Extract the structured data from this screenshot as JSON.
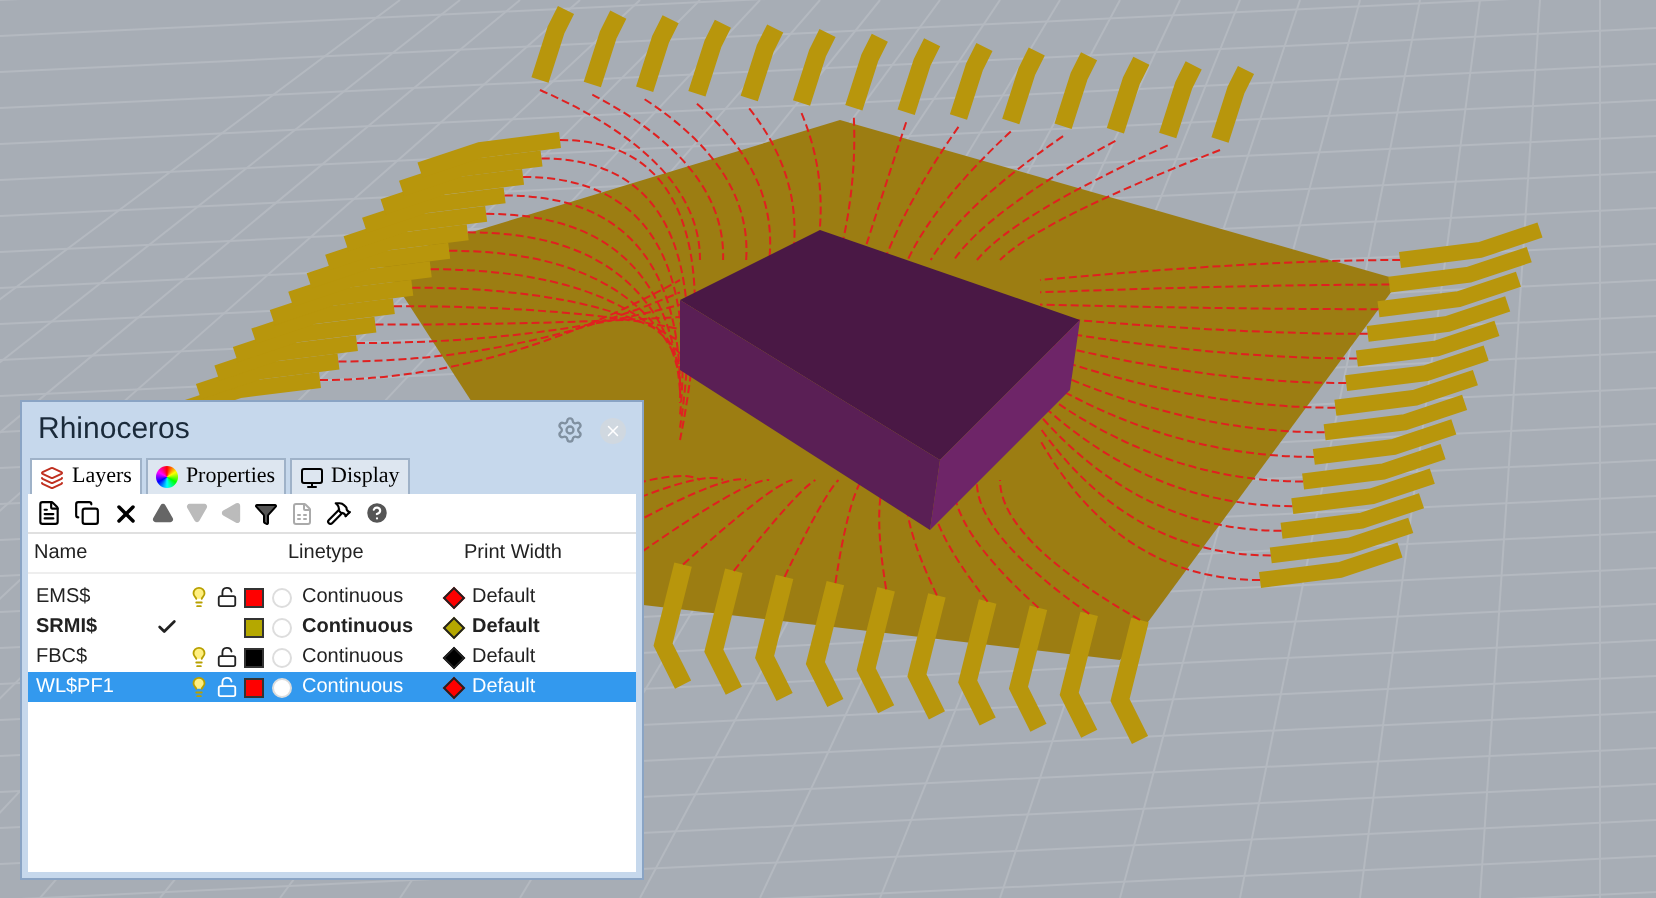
{
  "panel": {
    "title": "Rhinoceros",
    "tabs": [
      {
        "label": "Layers",
        "selected": true
      },
      {
        "label": "Properties",
        "selected": false
      },
      {
        "label": "Display",
        "selected": false
      }
    ],
    "columns": [
      "Name",
      "Linetype",
      "Print Width"
    ],
    "layers": [
      {
        "name": "EMS$",
        "current": false,
        "color": "#ff0000",
        "print_marker": {
          "color": "#ff0000"
        },
        "linetype": "Continuous",
        "print_width": "Default",
        "selected": false
      },
      {
        "name": "SRMI$",
        "current": true,
        "color": "#b5a800",
        "print_marker": {
          "color": "#b5a800"
        },
        "linetype": "Continuous",
        "print_width": "Default",
        "selected": false
      },
      {
        "name": "FBC$",
        "current": false,
        "color": "#000000",
        "print_marker": {
          "color": "#000000"
        },
        "linetype": "Continuous",
        "print_width": "Default",
        "selected": false
      },
      {
        "name": "WL$PF1",
        "current": false,
        "color": "#ff0000",
        "print_marker": {
          "color": "#ff0000"
        },
        "linetype": "Continuous",
        "print_width": "Default",
        "selected": true
      }
    ]
  }
}
